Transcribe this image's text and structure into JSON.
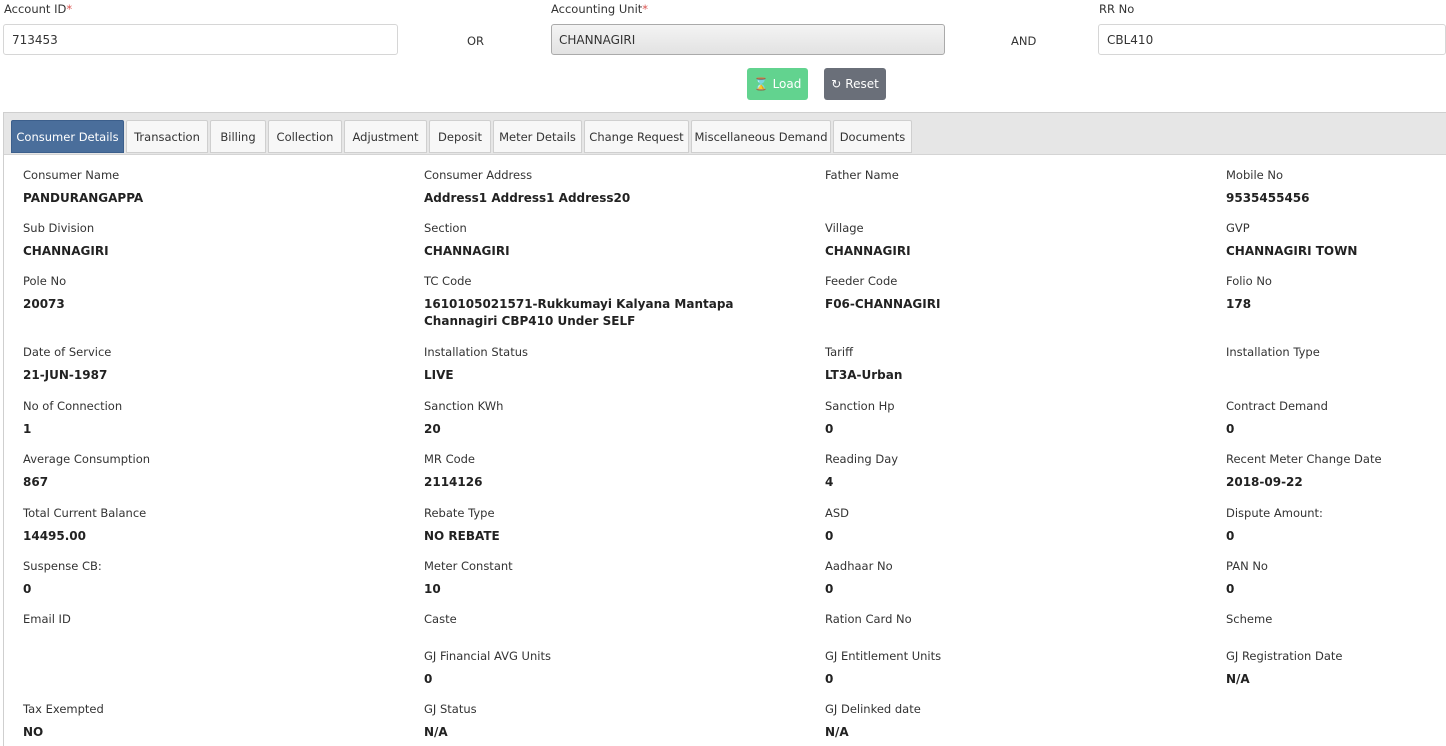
{
  "search": {
    "account_id": {
      "label": "Account ID",
      "value": "713453"
    },
    "or_text": "OR",
    "accounting_unit": {
      "label": "Accounting Unit",
      "value": "CHANNAGIRI"
    },
    "and_text": "AND",
    "rr_no": {
      "label": "RR No",
      "value": "CBL410"
    },
    "required_mark": "*",
    "load_label": "Load",
    "reset_label": "Reset"
  },
  "tabs": [
    "Consumer Details",
    "Transaction",
    "Billing",
    "Collection",
    "Adjustment",
    "Deposit",
    "Meter Details",
    "Change Request",
    "Miscellaneous Demand",
    "Documents"
  ],
  "details": [
    [
      {
        "label": "Consumer Name",
        "value": "PANDURANGAPPA"
      },
      {
        "label": "Consumer Address",
        "value": "Address1 Address1 Address20"
      },
      {
        "label": "Father Name",
        "value": ""
      },
      {
        "label": "Mobile No",
        "value": "9535455456"
      }
    ],
    [
      {
        "label": "Sub Division",
        "value": "CHANNAGIRI"
      },
      {
        "label": "Section",
        "value": "CHANNAGIRI"
      },
      {
        "label": "Village",
        "value": "CHANNAGIRI"
      },
      {
        "label": "GVP",
        "value": "CHANNAGIRI TOWN"
      }
    ],
    [
      {
        "label": "Pole No",
        "value": "20073"
      },
      {
        "label": "TC Code",
        "value": "1610105021571-Rukkumayi Kalyana Mantapa Channagiri CBP410 Under SELF"
      },
      {
        "label": "Feeder Code",
        "value": "F06-CHANNAGIRI"
      },
      {
        "label": "Folio No",
        "value": "178"
      }
    ],
    [
      {
        "label": "Date of Service",
        "value": "21-JUN-1987"
      },
      {
        "label": "Installation Status",
        "value": "LIVE"
      },
      {
        "label": "Tariff",
        "value": "LT3A-Urban"
      },
      {
        "label": "Installation Type",
        "value": ""
      }
    ],
    [
      {
        "label": "No of Connection",
        "value": "1"
      },
      {
        "label": "Sanction KWh",
        "value": "20"
      },
      {
        "label": "Sanction Hp",
        "value": "0"
      },
      {
        "label": "Contract Demand",
        "value": "0"
      }
    ],
    [
      {
        "label": "Average Consumption",
        "value": "867"
      },
      {
        "label": "MR Code",
        "value": "2114126"
      },
      {
        "label": "Reading Day",
        "value": "4"
      },
      {
        "label": "Recent Meter Change Date",
        "value": "2018-09-22"
      }
    ],
    [
      {
        "label": "Total Current Balance",
        "value": "14495.00"
      },
      {
        "label": "Rebate Type",
        "value": "NO REBATE"
      },
      {
        "label": "ASD",
        "value": "0"
      },
      {
        "label": "Dispute Amount:",
        "value": "0"
      }
    ],
    [
      {
        "label": "Suspense CB:",
        "value": "0"
      },
      {
        "label": "Meter Constant",
        "value": "10"
      },
      {
        "label": "Aadhaar No",
        "value": "0"
      },
      {
        "label": "PAN No",
        "value": "0"
      }
    ],
    [
      {
        "label": "Email ID",
        "value": ""
      },
      {
        "label": "Caste",
        "value": ""
      },
      {
        "label": "Ration Card No",
        "value": ""
      },
      {
        "label": "Scheme",
        "value": ""
      }
    ],
    [
      {
        "label": "",
        "value": ""
      },
      {
        "label": "GJ Financial AVG Units",
        "value": "0"
      },
      {
        "label": "GJ Entitlement Units",
        "value": "0"
      },
      {
        "label": "GJ Registration Date",
        "value": "N/A"
      }
    ],
    [
      {
        "label": "Tax Exempted",
        "value": "NO"
      },
      {
        "label": "GJ Status",
        "value": "N/A"
      },
      {
        "label": "GJ Delinked date",
        "value": "N/A"
      },
      {
        "label": "",
        "value": ""
      }
    ]
  ]
}
